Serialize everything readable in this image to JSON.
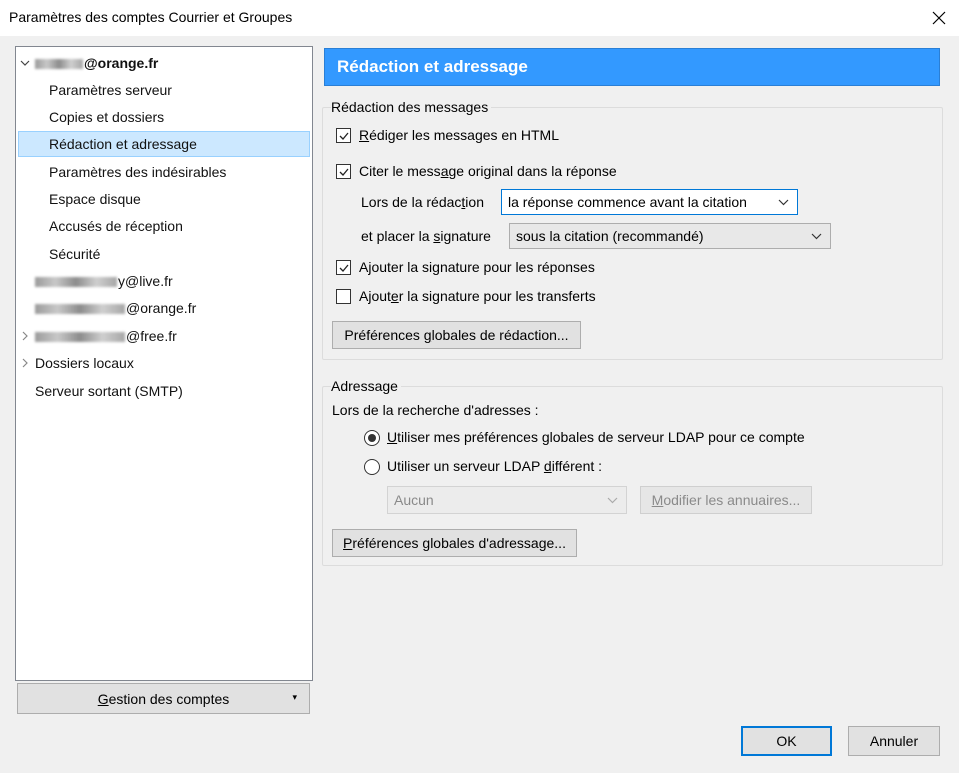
{
  "window": {
    "title": "Paramètres des comptes Courrier et Groupes",
    "close_glyph": "×"
  },
  "tree": {
    "accounts": [
      {
        "name_suffix": "@orange.fr",
        "expanded": true,
        "children": [
          "Paramètres serveur",
          "Copies et dossiers",
          "Rédaction et adressage",
          "Paramètres des indésirables",
          "Espace disque",
          "Accusés de réception",
          "Sécurité"
        ]
      },
      {
        "name_suffix": "y@live.fr"
      },
      {
        "name_suffix": "@orange.fr"
      },
      {
        "name_suffix": "@free.fr"
      }
    ],
    "local_folders": "Dossiers locaux",
    "smtp": "Serveur sortant (SMTP)",
    "selected": "Rédaction et adressage"
  },
  "account_actions": {
    "label_pre": "",
    "label_key": "G",
    "label_post": "estion des comptes",
    "arrow": "▾"
  },
  "pane": {
    "title": "Rédaction et adressage"
  },
  "composition": {
    "legend": "Rédaction des messages",
    "html_pre": "",
    "html_key": "R",
    "html_post": "édiger les messages en HTML",
    "html_checked": true,
    "quote_pre": "Citer le mess",
    "quote_key": "a",
    "quote_post": "ge original dans la réponse",
    "quote_checked": true,
    "reply_label_pre": "Lors de la rédac",
    "reply_label_key": "t",
    "reply_label_post": "ion",
    "reply_value": "la réponse commence avant la citation",
    "sig_label_pre": "et placer la ",
    "sig_label_key": "s",
    "sig_label_post": "ignature",
    "sig_value": "sous la citation (recommandé)",
    "sig_reply_pre": "A",
    "sig_reply_key": "j",
    "sig_reply_post": "outer la signature pour les réponses",
    "sig_reply_checked": true,
    "sig_fwd_pre": "Ajout",
    "sig_fwd_key": "e",
    "sig_fwd_post": "r la signature pour les transferts",
    "sig_fwd_checked": false,
    "global_btn_pre": "Préférences ",
    "global_btn_key": "g",
    "global_btn_post": "lobales de rédaction..."
  },
  "addressing": {
    "legend": "Adressage",
    "lookup_label": "Lors de la recherche d'adresses :",
    "opt1_pre": "",
    "opt1_key": "U",
    "opt1_post": "tiliser mes préférences globales de serveur LDAP pour ce compte",
    "opt1_selected": true,
    "opt2_pre": "Utiliser un serveur LDAP ",
    "opt2_key": "d",
    "opt2_post": "ifférent :",
    "opt2_selected": false,
    "ldap_value": "Aucun",
    "edit_dirs_pre": "",
    "edit_dirs_key": "M",
    "edit_dirs_post": "odifier les annuaires...",
    "global_btn_pre": "",
    "global_btn_key": "P",
    "global_btn_post": "références globales d'adressage..."
  },
  "footer": {
    "ok": "OK",
    "cancel": "Annuler"
  }
}
